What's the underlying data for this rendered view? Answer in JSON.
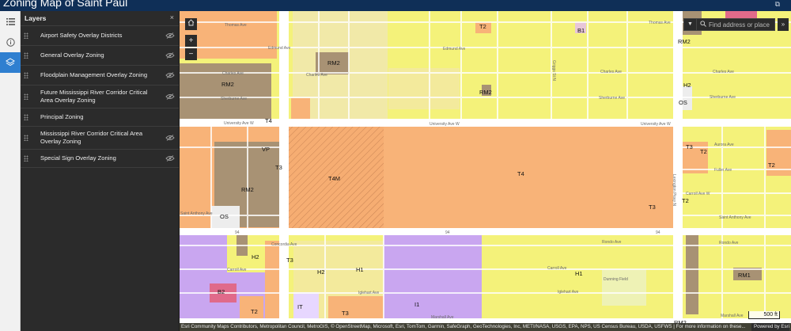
{
  "app": {
    "title": "Zoning Map of Saint Paul"
  },
  "rail": {
    "items": [
      "layers-list",
      "information",
      "layers"
    ]
  },
  "layers_panel": {
    "title": "Layers",
    "close": "×",
    "layers": [
      "Airport Safety Overlay Districts",
      "General Overlay Zoning",
      "Floodplain Management Overlay Zoning",
      "Future Mississippi River Corridor Critical Area Overlay Zoning",
      "Principal Zoning",
      "Mississippi River Corridor Critical Area Overlay Zoning",
      "Special Sign Overlay Zoning"
    ]
  },
  "map": {
    "search_placeholder": "Find address or place",
    "scale_label": "500 ft",
    "attribution": "Esri Community Maps Contributors, Metropolitan Council, MetroGIS, © OpenStreetMap, Microsoft, Esri, TomTom, Garmin, SafeGraph, GeoTechnologies, Inc, METI/NASA, USGS, EPA, NPS, US Census Bureau, USDA, USFWS | For more information on these...",
    "powered_by": "Powered by Esri",
    "zoom_in": "+",
    "zoom_out": "−",
    "expand": "»",
    "colors": {
      "residential": "#f4f27a",
      "rm": "#a89274",
      "traditional": "#f8b378",
      "industrial": "#c9a6f0",
      "b": "#e8c6d8",
      "b2": "#e06a8a",
      "os": "#ededed",
      "road": "#ffffff"
    },
    "zone_labels": [
      {
        "text": "T2",
        "name": "zone-t2-thomas"
      },
      {
        "text": "B1",
        "name": "zone-b1"
      },
      {
        "text": "RM2",
        "name": "zone-rm2-ne"
      },
      {
        "text": "RM2",
        "name": "zone-rm2-edmund"
      },
      {
        "text": "RM2",
        "name": "zone-rm2-west"
      },
      {
        "text": "RM2",
        "name": "zone-rm2-sherburne"
      },
      {
        "text": "H2",
        "name": "zone-h2-east"
      },
      {
        "text": "OS",
        "name": "zone-os-east"
      },
      {
        "text": "T4",
        "name": "zone-t4-university"
      },
      {
        "text": "VP",
        "name": "zone-vp"
      },
      {
        "text": "T3",
        "name": "zone-t3-dunlap"
      },
      {
        "text": "T4M",
        "name": "zone-t4m"
      },
      {
        "text": "RM2",
        "name": "zone-rm2-central"
      },
      {
        "text": "OS",
        "name": "zone-os-west"
      },
      {
        "text": "T4",
        "name": "zone-t4-center"
      },
      {
        "text": "T3",
        "name": "zone-t3-east"
      },
      {
        "text": "T2",
        "name": "zone-t2-lexington"
      },
      {
        "text": "T3",
        "name": "zone-t3-aurora"
      },
      {
        "text": "T2",
        "name": "zone-t2-fuller"
      },
      {
        "text": "T2",
        "name": "zone-t2-far-east"
      },
      {
        "text": "H2",
        "name": "zone-h2-concordia"
      },
      {
        "text": "T3",
        "name": "zone-t3-concordia"
      },
      {
        "text": "H2",
        "name": "zone-h2-carroll"
      },
      {
        "text": "H1",
        "name": "zone-h1-west"
      },
      {
        "text": "H1",
        "name": "zone-h1-east"
      },
      {
        "text": "RM1",
        "name": "zone-rm1"
      },
      {
        "text": "B2",
        "name": "zone-b2"
      },
      {
        "text": "IT",
        "name": "zone-it"
      },
      {
        "text": "I1",
        "name": "zone-i1"
      },
      {
        "text": "T2",
        "name": "zone-t2-marshall"
      },
      {
        "text": "T3",
        "name": "zone-t3-marshall"
      },
      {
        "text": "RM2",
        "name": "zone-rm2-south"
      }
    ],
    "street_labels": [
      {
        "text": "Thomas Ave",
        "name": "street-thomas-ave-w"
      },
      {
        "text": "Thomas Ave",
        "name": "street-thomas-ave-e"
      },
      {
        "text": "Edmund Ave",
        "name": "street-edmund-ave-w"
      },
      {
        "text": "Edmund Ave",
        "name": "street-edmund-ave-e"
      },
      {
        "text": "Charles Ave",
        "name": "street-charles-ave-w"
      },
      {
        "text": "Charles Ave",
        "name": "street-charles-ave-c"
      },
      {
        "text": "Charles Ave",
        "name": "street-charles-ave-e"
      },
      {
        "text": "Charles Ave",
        "name": "street-charles-ave-far"
      },
      {
        "text": "Sherburne Ave",
        "name": "street-sherburne-ave-w"
      },
      {
        "text": "Sherburne Ave",
        "name": "street-sherburne-ave-e"
      },
      {
        "text": "Sherburne Ave",
        "name": "street-sherburne-ave-far"
      },
      {
        "text": "University Ave W",
        "name": "street-university-w"
      },
      {
        "text": "University Ave W",
        "name": "street-university-c"
      },
      {
        "text": "University Ave W",
        "name": "street-university-e"
      },
      {
        "text": "Aurora Ave",
        "name": "street-aurora-ave"
      },
      {
        "text": "Fuller Ave",
        "name": "street-fuller-ave"
      },
      {
        "text": "Carroll Ave W",
        "name": "street-carroll-ave-w"
      },
      {
        "text": "Saint Anthony Ave",
        "name": "street-saint-anthony-w"
      },
      {
        "text": "Saint Anthony Ave",
        "name": "street-saint-anthony-e"
      },
      {
        "text": "Rondo Ave",
        "name": "street-rondo-ave-e"
      },
      {
        "text": "Rondo Ave",
        "name": "street-rondo-ave-far"
      },
      {
        "text": "Concordia Ave",
        "name": "street-concordia-ave"
      },
      {
        "text": "Carroll Ave",
        "name": "street-carroll-ave-s"
      },
      {
        "text": "Carroll Ave",
        "name": "street-carroll-ave-c"
      },
      {
        "text": "Iglehart Ave",
        "name": "street-iglehart-ave"
      },
      {
        "text": "Iglehart Ave",
        "name": "street-iglehart-ave-e"
      },
      {
        "text": "Marshall Ave",
        "name": "street-marshall-ave"
      },
      {
        "text": "Marshall Ave",
        "name": "street-marshall-ave-e"
      },
      {
        "text": "Lexington Pkwy N",
        "name": "street-lexington-pkwy"
      },
      {
        "text": "Griggs St N",
        "name": "street-griggs-st"
      },
      {
        "text": "Dunning Field",
        "name": "poi-dunning-field"
      },
      {
        "text": "94",
        "name": "route-94-west"
      },
      {
        "text": "94",
        "name": "route-94-center"
      },
      {
        "text": "94",
        "name": "route-94-east"
      }
    ]
  }
}
